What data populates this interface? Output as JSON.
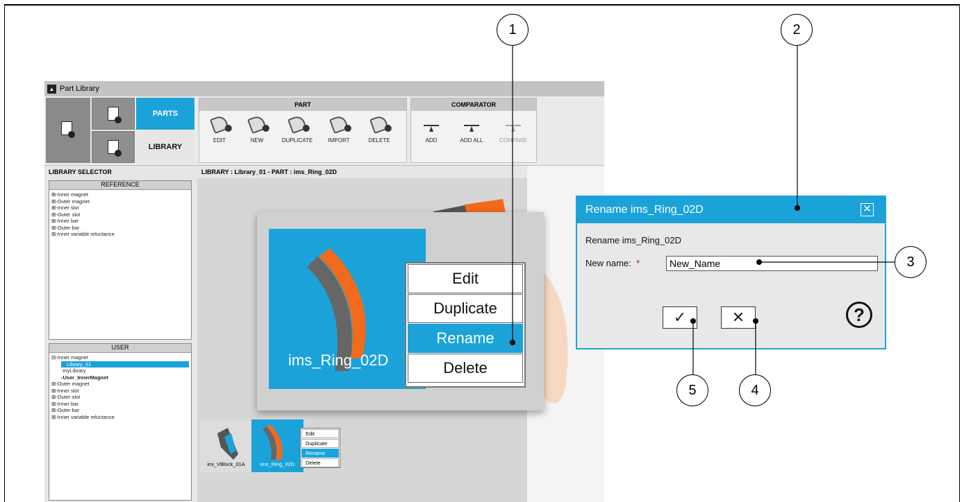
{
  "window": {
    "title": "Part Library"
  },
  "ribbon": {
    "tabs": [
      "PARTS",
      "LIBRARY"
    ],
    "part_group": {
      "label": "PART",
      "tools": [
        "EDIT",
        "NEW",
        "DUPLICATE",
        "IMPORT",
        "DELETE"
      ]
    },
    "comparator_group": {
      "label": "COMPARATOR",
      "tools": [
        "ADD",
        "ADD ALL",
        "COMPARE"
      ]
    }
  },
  "library_selector": {
    "title": "LIBRARY SELECTOR",
    "reference": {
      "title": "REFERENCE",
      "items": [
        "Inner magnet",
        "Outer magnet",
        "Inner slot",
        "Outer slot",
        "Inner bar",
        "Outer bar",
        "Inner variable reluctance"
      ]
    },
    "user": {
      "title": "USER",
      "root": "Inner magnet",
      "children": [
        "Library_01",
        "myLibrary",
        "User_InnerMagnet"
      ],
      "items": [
        "Outer magnet",
        "Inner slot",
        "Outer slot",
        "Inner bar",
        "Outer bar",
        "Inner variable reluctance"
      ]
    }
  },
  "main": {
    "header": "LIBRARY : Library_01  -  PART : ims_Ring_02D"
  },
  "zoom": {
    "part_name": "ims_Ring_02D",
    "context_menu": [
      "Edit",
      "Duplicate",
      "Rename",
      "Delete"
    ]
  },
  "parts": [
    {
      "name": "imi_VBlock_01A"
    },
    {
      "name": "ims_Ring_02D"
    }
  ],
  "small_context_menu": [
    "Edit",
    "Duplicate",
    "Rename",
    "Delete"
  ],
  "dialog": {
    "title": "Rename ims_Ring_02D",
    "message": "Rename ims_Ring_02D",
    "field_label": "New name:",
    "required_mark": "*",
    "field_value": "New_Name",
    "ok_symbol": "✓",
    "cancel_symbol": "✕",
    "help_symbol": "?",
    "close_symbol": "✕"
  },
  "callouts": [
    "1",
    "2",
    "3",
    "4",
    "5"
  ],
  "colors": {
    "accent": "#1ba3d9",
    "orange": "#f26a1b",
    "grey_part": "#666666"
  }
}
